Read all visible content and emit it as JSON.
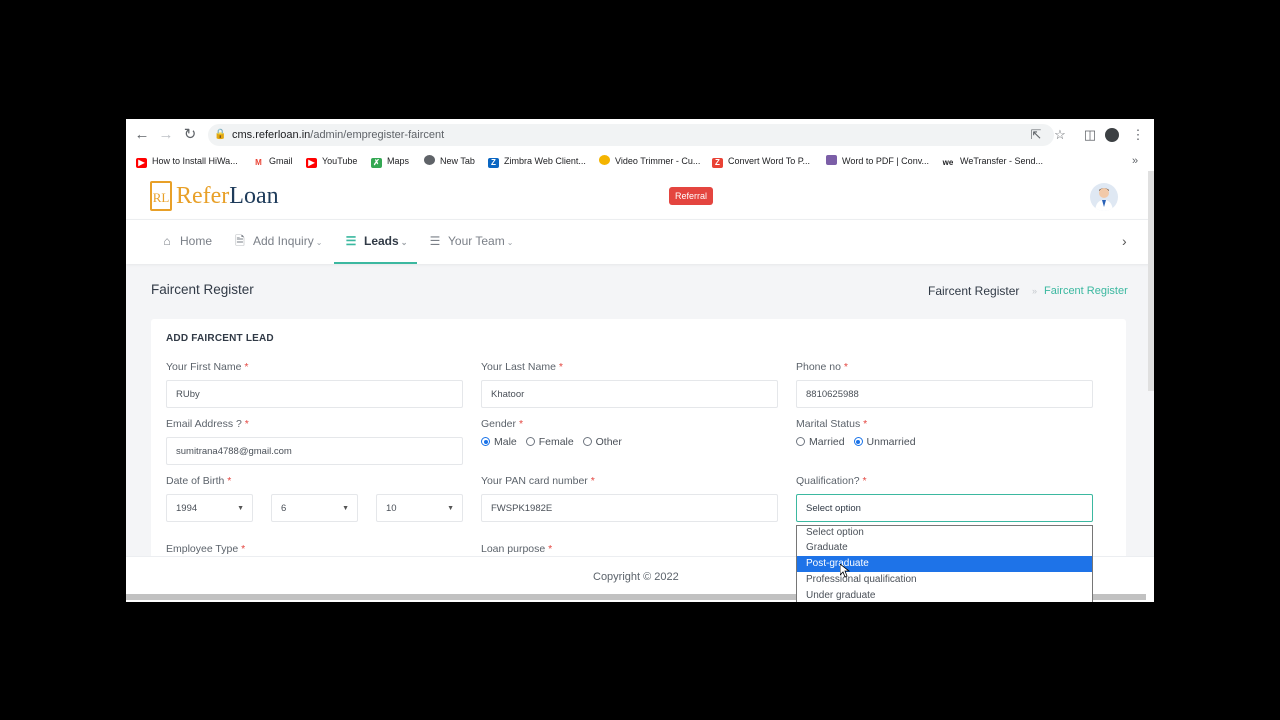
{
  "browser": {
    "url_domain": "cms.referloan.in",
    "url_path": "/admin/empregister-faircent",
    "bookmarks": [
      {
        "label": "How to Install HiWa...",
        "icon": "youtube-icon",
        "color": "#ff0000"
      },
      {
        "label": "Gmail",
        "icon": "gmail-icon",
        "color": "#ea4335"
      },
      {
        "label": "YouTube",
        "icon": "youtube-icon",
        "color": "#ff0000"
      },
      {
        "label": "Maps",
        "icon": "maps-icon",
        "color": "#34a853"
      },
      {
        "label": "New Tab",
        "icon": "globe-icon",
        "color": "#5f6368"
      },
      {
        "label": "Zimbra Web Client...",
        "icon": "zimbra-icon",
        "color": "#0a66c2"
      },
      {
        "label": "Video Trimmer - Cu...",
        "icon": "video-trimmer-icon",
        "color": "#f4b400"
      },
      {
        "label": "Convert Word To P...",
        "icon": "convert-icon",
        "color": "#e94235"
      },
      {
        "label": "Word to PDF | Conv...",
        "icon": "word-pdf-icon",
        "color": "#7b5ea7"
      },
      {
        "label": "WeTransfer - Send...",
        "icon": "wetransfer-icon",
        "color": "#202124"
      }
    ]
  },
  "header": {
    "logo_refer": "Refer",
    "logo_loan": "Loan",
    "logo_mark": "RL",
    "referral_badge": "Referral"
  },
  "menu": {
    "items": [
      {
        "label": "Home",
        "icon": "home-icon"
      },
      {
        "label": "Add Inquiry",
        "icon": "file-icon"
      },
      {
        "label": "Leads",
        "icon": "layers-icon"
      },
      {
        "label": "Your Team",
        "icon": "layers-icon"
      }
    ]
  },
  "page": {
    "title": "Faircent Register",
    "breadcrumb_parent": "Faircent Register",
    "breadcrumb_current": "Faircent Register"
  },
  "form": {
    "section_title": "ADD FAIRCENT LEAD",
    "first_name_label": "Your First Name",
    "first_name_value": "RUby",
    "last_name_label": "Your Last Name",
    "last_name_value": "Khatoor",
    "phone_label": "Phone no",
    "phone_value": "8810625988",
    "email_label": "Email Address ?",
    "email_value": "sumitrana4788@gmail.com",
    "gender_label": "Gender",
    "gender_options": [
      "Male",
      "Female",
      "Other"
    ],
    "marital_label": "Marital Status",
    "marital_options": [
      "Married",
      "Unmarried"
    ],
    "dob_label": "Date of Birth",
    "dob_year": "1994",
    "dob_month": "6",
    "dob_day": "10",
    "pan_label": "Your PAN card number",
    "pan_value": "FWSPK1982E",
    "qualification_label": "Qualification?",
    "qualification_value": "Select option",
    "employee_type_label": "Employee Type",
    "loan_purpose_label": "Loan purpose",
    "required_mark": "*"
  },
  "qualification_dropdown": {
    "options": [
      "Select option",
      "Graduate",
      "Post-graduate",
      "Professional qualification",
      "Under graduate"
    ]
  },
  "footer": {
    "copyright": "Copyright © 2022"
  }
}
